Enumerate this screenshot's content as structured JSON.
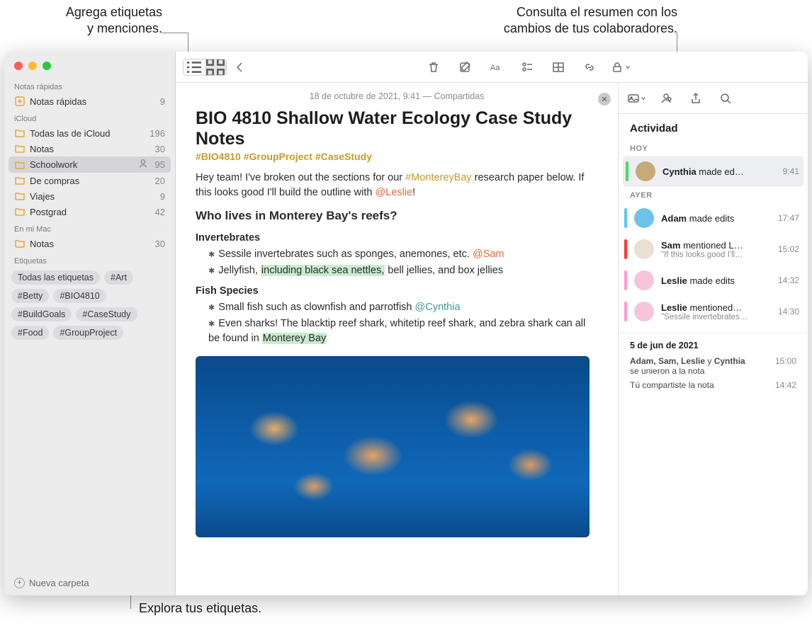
{
  "callouts": {
    "top_left": "Agrega etiquetas\ny menciones.",
    "top_right": "Consulta el resumen con los\ncambios de tus colaboradores.",
    "bottom": "Explora tus etiquetas."
  },
  "sidebar": {
    "sections": {
      "quick": {
        "header": "Notas rápidas",
        "item": {
          "label": "Notas rápidas",
          "count": "9"
        }
      },
      "icloud": {
        "header": "iCloud",
        "items": [
          {
            "label": "Todas las de iCloud",
            "count": "196"
          },
          {
            "label": "Notas",
            "count": "30"
          },
          {
            "label": "Schoolwork",
            "count": "95",
            "shared": true,
            "selected": true
          },
          {
            "label": "De compras",
            "count": "20"
          },
          {
            "label": "Viajes",
            "count": "9"
          },
          {
            "label": "Postgrad",
            "count": "42"
          }
        ]
      },
      "mac": {
        "header": "En mi Mac",
        "items": [
          {
            "label": "Notas",
            "count": "30"
          }
        ]
      },
      "tags_header": "Etiquetas"
    },
    "tags": [
      "Todas las etiquetas",
      "#Art",
      "#Betty",
      "#BIO4810",
      "#BuildGoals",
      "#CaseStudy",
      "#Food",
      "#GroupProject"
    ],
    "footer": "Nueva carpeta"
  },
  "note": {
    "meta": "18 de octubre de 2021, 9:41 — Compartidas",
    "title": "BIO 4810 Shallow Water Ecology Case Study Notes",
    "tags": "#BIO4810 #GroupProject #CaseStudy",
    "intro_a": "Hey team! I've broken out the sections for our ",
    "intro_tag": "#MontereyBay",
    "intro_b": " research paper below. If this looks good I'll build the outline with ",
    "intro_mention": "@Leslie",
    "intro_c": "!",
    "h_reef": "Who lives in Monterey Bay's reefs?",
    "h_invert": "Invertebrates",
    "invert1_a": "Sessile invertebrates such as sponges, anemones, etc. ",
    "invert1_m": "@Sam",
    "invert2_a": "Jellyfish, ",
    "invert2_hl": "including black sea nettles,",
    "invert2_b": " bell jellies, and box jellies",
    "h_fish": "Fish Species",
    "fish1_a": "Small fish such as clownfish and parrotfish ",
    "fish1_m": "@Cynthia",
    "fish2_a": "Even sharks! The blacktip reef shark, whitetip reef shark, and zebra shark can all be found in ",
    "fish2_hl": "Monterey Bay"
  },
  "activity": {
    "title": "Actividad",
    "today": "HOY",
    "yesterday": "AYER",
    "items_today": [
      {
        "name": "Cynthia",
        "rest": " made ed…",
        "time": "9:41",
        "bar": "#4cd964",
        "avatar": "#c7a97a"
      }
    ],
    "items_yesterday": [
      {
        "name": "Adam",
        "rest": " made edits",
        "time": "17:47",
        "bar": "#5ac8fa",
        "avatar": "#6ec3e6"
      },
      {
        "name": "Sam",
        "rest": " mentioned L…",
        "sub": "\"If this looks good I'll…",
        "time": "15:02",
        "bar": "#ff3b30",
        "avatar": "#e8e0d0"
      },
      {
        "name": "Leslie",
        "rest": " made edits",
        "time": "14:32",
        "bar": "#ff9ad5",
        "avatar": "#f5c6d8"
      },
      {
        "name": "Leslie",
        "rest": " mentioned…",
        "sub": "\"Sessile invertebrates…",
        "time": "14:30",
        "bar": "#ff9ad5",
        "avatar": "#f5c6d8"
      }
    ],
    "date_block": {
      "head": "5 de jun de 2021",
      "row1_a": "Adam, Sam, Leslie",
      "row1_b": " y ",
      "row1_c": "Cynthia",
      "row1_d": " se unieron a la nota",
      "row1_t": "15:00",
      "row2": "Tú compartiste la nota",
      "row2_t": "14:42"
    }
  }
}
